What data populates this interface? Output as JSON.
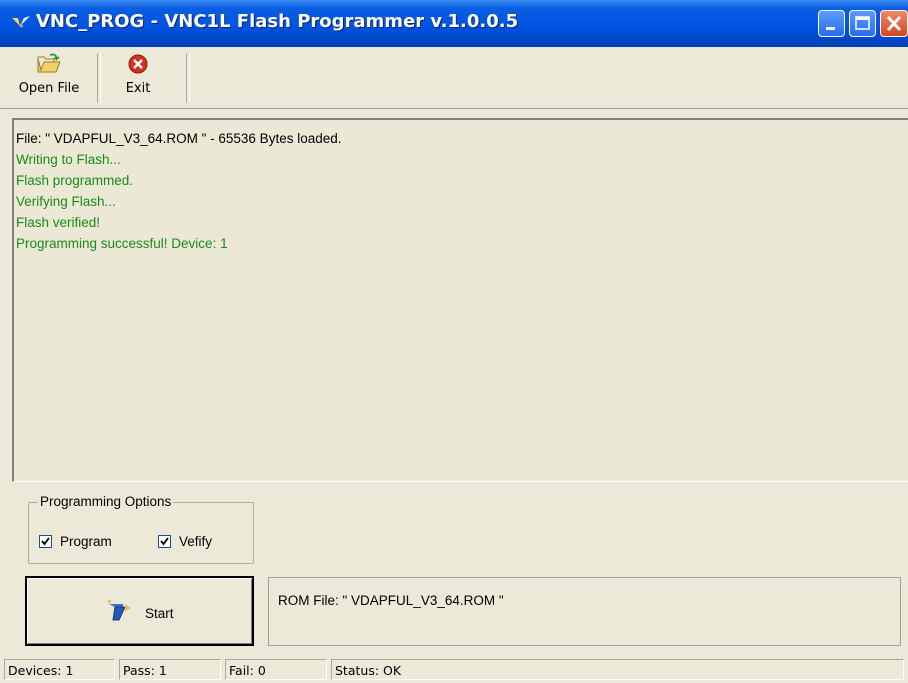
{
  "window": {
    "title": "VNC_PROG - VNC1L Flash Programmer v.1.0.0.5",
    "app_icon": "vnc-logo-icon"
  },
  "toolbar": {
    "open_label": "Open File",
    "open_icon": "folder-open-icon",
    "exit_label": "Exit",
    "exit_icon": "exit-icon"
  },
  "log": {
    "lines": [
      "File: \" VDAPFUL_V3_64.ROM \" - 65536 Bytes loaded.",
      "Writing to Flash...",
      "Flash programmed.",
      "Verifying Flash...",
      "Flash verified!",
      "Programming successful! Device: 1"
    ],
    "success_color": "#1a8a1a"
  },
  "options": {
    "legend": "Programming Options",
    "program_label": "Program",
    "program_checked": true,
    "verify_label": "Vefify",
    "verify_checked": true
  },
  "start": {
    "label": "Start",
    "icon": "start-program-icon"
  },
  "rom_info": "ROM File: \" VDAPFUL_V3_64.ROM \"",
  "status": {
    "devices": "Devices: 1",
    "pass": "Pass: 1",
    "fail": "Fail: 0",
    "status": "Status: OK"
  }
}
